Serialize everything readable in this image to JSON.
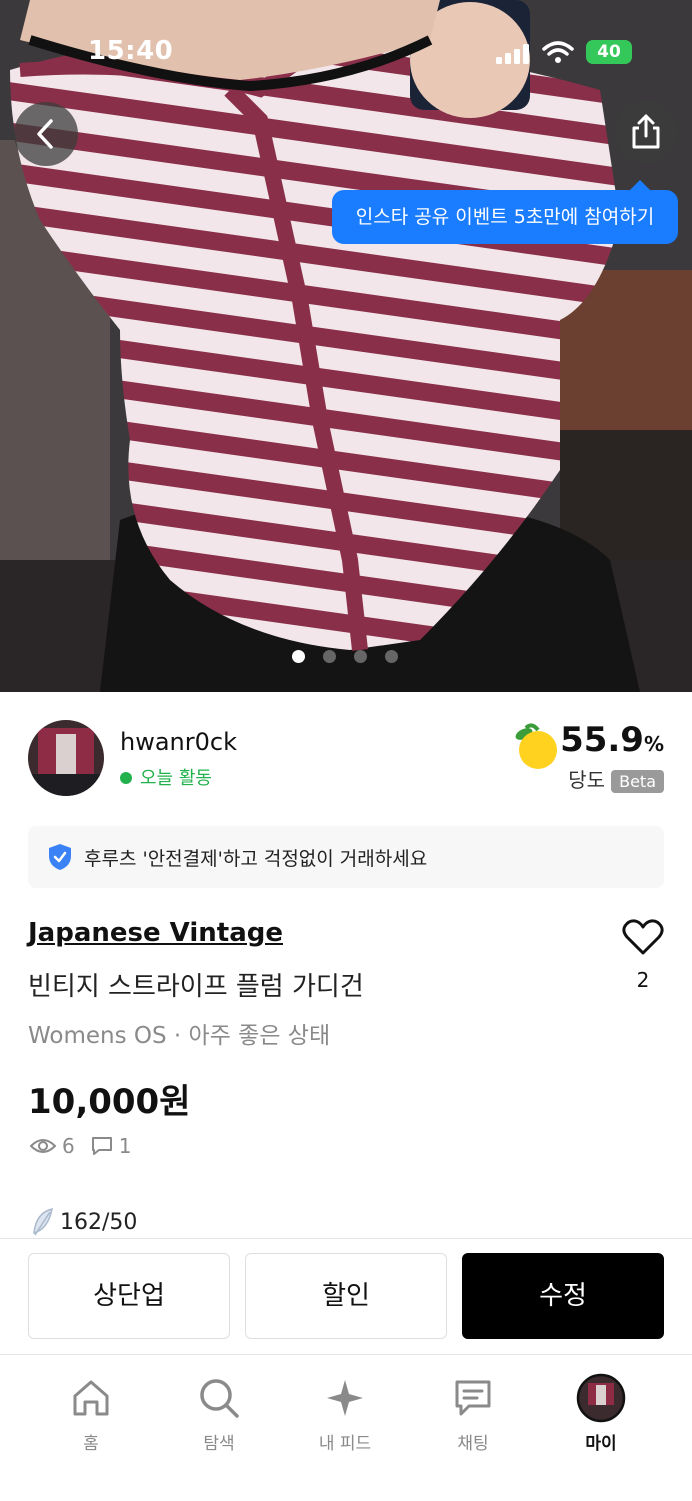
{
  "status_bar": {
    "time": "15:40",
    "battery": "40"
  },
  "hero": {
    "share_tooltip": "인스타 공유 이벤트 5초만에 참여하기",
    "slide_count": 4,
    "active_slide": 1
  },
  "seller": {
    "name": "hwanr0ck",
    "activity": "오늘 활동",
    "score_value": "55.9",
    "score_unit": "%",
    "score_label": "당도",
    "score_badge": "Beta"
  },
  "safe_notice": "후루츠 '안전결제'하고 걱정없이 거래하세요",
  "product": {
    "brand": "Japanese Vintage",
    "title": "빈티지 스트라이프 플럼 가디건",
    "meta": "Womens OS · 아주 좋은 상태",
    "price": "10,000원",
    "views": "6",
    "comments": "1",
    "likes": "2",
    "seller_score": "162/50"
  },
  "actions": {
    "bump": "상단업",
    "discount": "할인",
    "edit": "수정"
  },
  "tabs": [
    {
      "label": "홈",
      "icon": "home-icon"
    },
    {
      "label": "탐색",
      "icon": "search-icon"
    },
    {
      "label": "내 피드",
      "icon": "sparkle-icon"
    },
    {
      "label": "채팅",
      "icon": "chat-icon"
    },
    {
      "label": "마이",
      "icon": "avatar"
    }
  ],
  "colors": {
    "accent": "#1a7cff",
    "online": "#22b14c",
    "primary_button": "#000000",
    "stripe": "#8a2f4a"
  }
}
